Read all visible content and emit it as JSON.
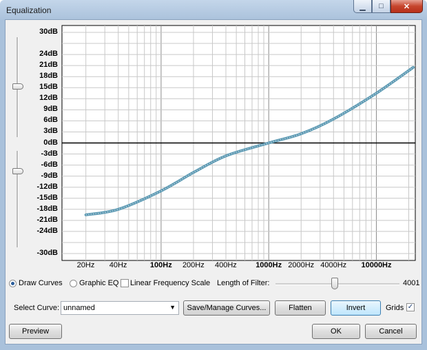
{
  "window": {
    "title": "Equalization"
  },
  "db_labels": [
    "30dB",
    "24dB",
    "21dB",
    "18dB",
    "15dB",
    "12dB",
    "9dB",
    "6dB",
    "3dB",
    "0dB",
    "-3dB",
    "-6dB",
    "-9dB",
    "-12dB",
    "-15dB",
    "-18dB",
    "-21dB",
    "-24dB",
    "-30dB"
  ],
  "db_values": [
    30,
    24,
    21,
    18,
    15,
    12,
    9,
    6,
    3,
    0,
    -3,
    -6,
    -9,
    -12,
    -15,
    -18,
    -21,
    -24,
    -30
  ],
  "hz_labels": [
    {
      "text": "20Hz",
      "freq": 20,
      "major": false
    },
    {
      "text": "40Hz",
      "freq": 40,
      "major": false
    },
    {
      "text": "100Hz",
      "freq": 100,
      "major": true
    },
    {
      "text": "200Hz",
      "freq": 200,
      "major": false
    },
    {
      "text": "400Hz",
      "freq": 400,
      "major": false
    },
    {
      "text": "1000Hz",
      "freq": 1000,
      "major": true
    },
    {
      "text": "2000Hz",
      "freq": 2000,
      "major": false
    },
    {
      "text": "4000Hz",
      "freq": 4000,
      "major": false
    },
    {
      "text": "10000Hz",
      "freq": 10000,
      "major": true
    }
  ],
  "curve_points": [
    [
      20,
      -19.5
    ],
    [
      40,
      -18
    ],
    [
      100,
      -13
    ],
    [
      200,
      -8
    ],
    [
      400,
      -3.5
    ],
    [
      1000,
      0
    ],
    [
      2000,
      2.5
    ],
    [
      4000,
      6.5
    ],
    [
      10000,
      13.5
    ],
    [
      22000,
      20.5
    ]
  ],
  "options": {
    "draw_curves": "Draw Curves",
    "graphic_eq": "Graphic EQ",
    "linear_freq": "Linear Frequency Scale",
    "filter_length_label": "Length of Filter:",
    "filter_length_value": "4001",
    "filter_length_fraction": 0.48
  },
  "curve_row": {
    "label": "Select Curve:",
    "selected": "unnamed",
    "save_manage": "Save/Manage Curves...",
    "flatten": "Flatten",
    "invert": "Invert",
    "grids": "Grids"
  },
  "footer": {
    "preview": "Preview",
    "ok": "OK",
    "cancel": "Cancel"
  },
  "colors": {
    "curve": "#5b9ab4",
    "curve_dots": "#c8d4dc",
    "grid": "#c8c8c8",
    "zero_line": "#000000"
  }
}
